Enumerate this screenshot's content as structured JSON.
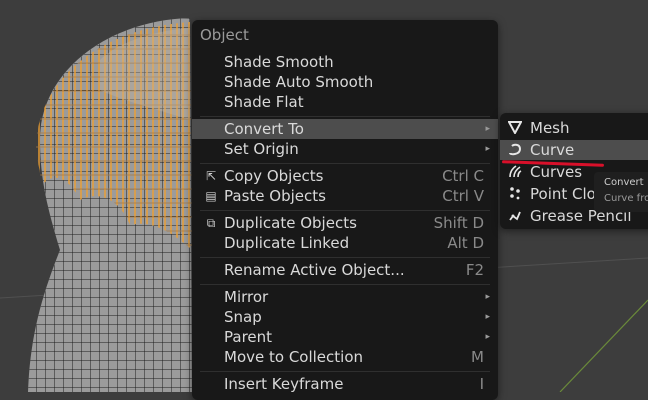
{
  "menu": {
    "title": "Object",
    "items": [
      {
        "label": "Shade Smooth"
      },
      {
        "label": "Shade Auto Smooth"
      },
      {
        "label": "Shade Flat"
      },
      {
        "label": "Convert To",
        "arrow": "▸"
      },
      {
        "label": "Set Origin",
        "arrow": "▸"
      },
      {
        "label": "Copy Objects",
        "shortcut": "Ctrl C"
      },
      {
        "label": "Paste Objects",
        "shortcut": "Ctrl V"
      },
      {
        "label": "Duplicate Objects",
        "shortcut": "Shift D"
      },
      {
        "label": "Duplicate Linked",
        "shortcut": "Alt D"
      },
      {
        "label": "Rename Active Object...",
        "shortcut": "F2"
      },
      {
        "label": "Mirror",
        "arrow": "▸"
      },
      {
        "label": "Snap",
        "arrow": "▸"
      },
      {
        "label": "Parent",
        "arrow": "▸"
      },
      {
        "label": "Move to Collection",
        "shortcut": "M"
      },
      {
        "label": "Insert Keyframe",
        "shortcut": "I"
      }
    ]
  },
  "submenu": {
    "items": [
      {
        "label": "Mesh",
        "icon": "mesh-icon"
      },
      {
        "label": "Curve",
        "icon": "curve-icon"
      },
      {
        "label": "Curves",
        "icon": "curves-icon"
      },
      {
        "label": "Point Cloud",
        "icon": "point-cloud-icon"
      },
      {
        "label": "Grease Pencil",
        "icon": "grease-pencil-icon"
      }
    ]
  },
  "tooltip": {
    "line1": "Convert",
    "line2": "Curve fro"
  },
  "colors": {
    "accent": "#d8102a",
    "wire": "#f0a030",
    "menu_bg": "#181818"
  }
}
